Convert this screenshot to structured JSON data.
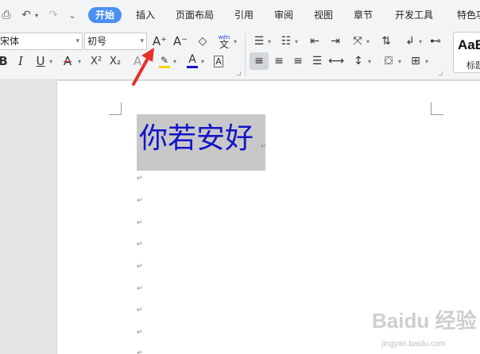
{
  "menubar": {
    "tabs": [
      {
        "label": "开始",
        "active": true
      },
      {
        "label": "插入"
      },
      {
        "label": "页面布局"
      },
      {
        "label": "引用"
      },
      {
        "label": "审阅"
      },
      {
        "label": "视图"
      },
      {
        "label": "章节"
      },
      {
        "label": "开发工具"
      },
      {
        "label": "特色功"
      }
    ],
    "quick_icons": [
      "print-preview-icon",
      "undo-icon",
      "redo-icon",
      "customize-toolbar-icon"
    ]
  },
  "ribbon": {
    "font_name": "宋体",
    "font_size": "初号",
    "grow_font_label": "A⁺",
    "shrink_font_label": "A⁻",
    "clear_format_label": "⌫",
    "phonetic_label": "wén",
    "bold_label": "B",
    "italic_label": "I",
    "underline_label": "U",
    "strike_label": "A",
    "superscript_label": "X²",
    "subscript_label": "X₂",
    "text_effect_label": "A",
    "highlight_label": "✎",
    "font_color_label": "A",
    "char_border_label": "A",
    "style_preview": "AaB",
    "style_name": "标题"
  },
  "colors": {
    "accent": "#4a8ff2",
    "font_color": "#1414c8",
    "highlight": "#f2d40a",
    "pointer": "#e8302a"
  },
  "document": {
    "text": "你若安好"
  },
  "watermark": {
    "logo": "Baidu 经验",
    "url": "jingyan.baidu.com"
  }
}
